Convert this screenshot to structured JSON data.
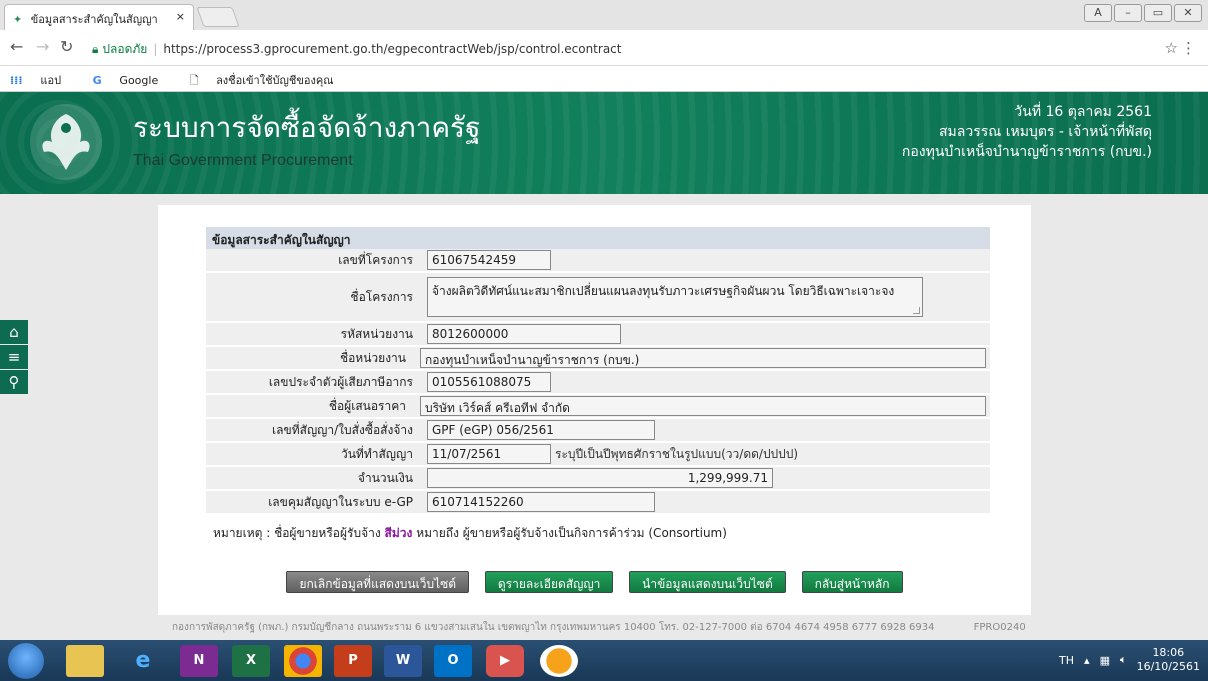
{
  "browser": {
    "tab_title": "ข้อมูลสาระสำคัญในสัญญา",
    "tab_close": "×",
    "secure_label": "ปลอดภัย",
    "url": "https://process3.gprocurement.go.th/egpecontractWeb/jsp/control.econtract",
    "bookmarks": {
      "apps": "แอป",
      "google": "Google",
      "signin": "ลงชื่อเข้าใช้บัญชีของคุณ"
    }
  },
  "header": {
    "title_th": "ระบบการจัดซื้อจัดจ้างภาครัฐ",
    "title_en": "Thai Government Procurement",
    "date": "วันที่ 16 ตุลาคม 2561",
    "user": "สมลวรรณ เหมบุตร - เจ้าหน้าที่พัสดุ",
    "org": "กองทุนบำเหน็จบำนาญข้าราชการ (กบข.)"
  },
  "form": {
    "heading": "ข้อมูลสาระสำคัญในสัญญา",
    "fields": [
      {
        "label": "เลขที่โครงการ",
        "value": "61067542459"
      },
      {
        "label": "ชื่อโครงการ",
        "value": "จ้างผลิตวิดีทัศน์แนะสมาชิกเปลี่ยนแผนลงทุนรับภาวะเศรษฐกิจผันผวน โดยวิธีเฉพาะเจาะจง"
      },
      {
        "label": "รหัสหน่วยงาน",
        "value": "8012600000"
      },
      {
        "label": "ชื่อหน่วยงาน",
        "value": "กองทุนบำเหน็จบำนาญข้าราชการ (กบข.)"
      },
      {
        "label": "เลขประจำตัวผู้เสียภาษีอากร",
        "value": "0105561088075"
      },
      {
        "label": "ชื่อผู้เสนอราคา",
        "value": "บริษัท เวิร์คส์ ครีเอทีฟ จำกัด"
      },
      {
        "label": "เลขที่สัญญา/ใบสั่งซื้อสั่งจ้าง",
        "value": "GPF (eGP) 056/2561"
      },
      {
        "label": "วันที่ทำสัญญา",
        "value": "11/07/2561",
        "hint": "ระบุปีเป็นปีพุทธศักราชในรูปแบบ(วว/ดด/ปปปป)"
      },
      {
        "label": "จำนวนเงิน",
        "value": "1,299,999.71"
      },
      {
        "label": "เลขคุมสัญญาในระบบ e-GP",
        "value": "610714152260"
      }
    ],
    "note_prefix": "หมายเหตุ : ชื่อผู้ขายหรือผู้รับจ้าง",
    "note_purple": "สีม่วง",
    "note_suffix": "หมายถึง ผู้ขายหรือผู้รับจ้างเป็นกิจการค้าร่วม (Consortium)"
  },
  "buttons": {
    "cancel_display": "ยกเลิกข้อมูลที่แสดงบนเว็บไซต์",
    "view_detail": "ดูรายละเอียดสัญญา",
    "publish": "นำข้อมูลแสดงบนเว็บไซต์",
    "home": "กลับสู่หน้าหลัก"
  },
  "footer": {
    "text": "กองการพัสดุภาครัฐ (กพภ.) กรมบัญชีกลาง ถนนพระราม 6 แขวงสามเสนใน เขตพญาไท กรุงเทพมหานคร 10400 โทร. 02-127-7000 ต่อ 6704 4674 4958 6777 6928 6934",
    "code": "FPRO0240"
  },
  "taskbar": {
    "lang": "TH",
    "time": "18:06",
    "date": "16/10/2561",
    "apps": [
      "N",
      "X",
      "P",
      "W",
      "O"
    ]
  },
  "colors": {
    "banner": "#0a6e4f",
    "accent_green": "#117a3f",
    "purple_note": "#8b1a9b"
  }
}
